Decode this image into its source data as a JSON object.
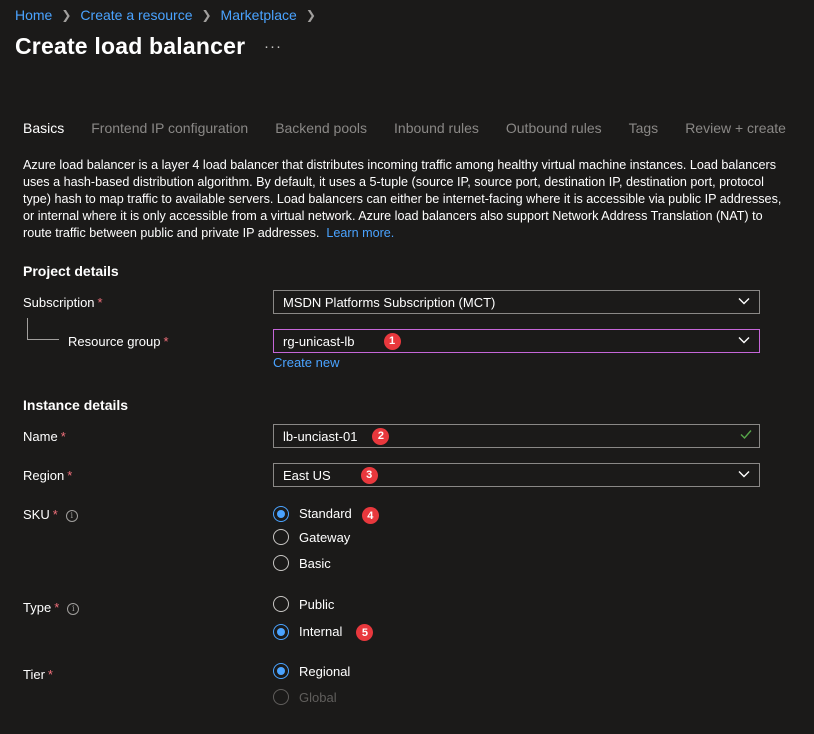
{
  "breadcrumb": {
    "home": "Home",
    "create_resource": "Create a resource",
    "marketplace": "Marketplace"
  },
  "page": {
    "title": "Create load balancer",
    "more": "···"
  },
  "tabs": [
    {
      "label": "Basics",
      "active": true
    },
    {
      "label": "Frontend IP configuration"
    },
    {
      "label": "Backend pools"
    },
    {
      "label": "Inbound rules"
    },
    {
      "label": "Outbound rules"
    },
    {
      "label": "Tags"
    },
    {
      "label": "Review + create"
    }
  ],
  "description": {
    "text": "Azure load balancer is a layer 4 load balancer that distributes incoming traffic among healthy virtual machine instances. Load balancers uses a hash-based distribution algorithm. By default, it uses a 5-tuple (source IP, source port, destination IP, destination port, protocol type) hash to map traffic to available servers. Load balancers can either be internet-facing where it is accessible via public IP addresses, or internal where it is only accessible from a virtual network. Azure load balancers also support Network Address Translation (NAT) to route traffic between public and private IP addresses.",
    "learn_more": "Learn more."
  },
  "project_details": {
    "heading": "Project details",
    "subscription_label": "Subscription",
    "subscription_value": "MSDN Platforms Subscription (MCT)",
    "resource_group_label": "Resource group",
    "resource_group_value": "rg-unicast-lb",
    "create_new": "Create new"
  },
  "instance_details": {
    "heading": "Instance details",
    "name_label": "Name",
    "name_value": "lb-unciast-01",
    "region_label": "Region",
    "region_value": "East US",
    "sku_label": "SKU",
    "sku_options": [
      "Standard",
      "Gateway",
      "Basic"
    ],
    "sku_selected": "Standard",
    "type_label": "Type",
    "type_options": [
      "Public",
      "Internal"
    ],
    "type_selected": "Internal",
    "tier_label": "Tier",
    "tier_options": [
      "Regional",
      "Global"
    ],
    "tier_selected": "Regional"
  },
  "required_marker": "*",
  "info_glyph": "i",
  "badges": [
    "1",
    "2",
    "3",
    "4",
    "5"
  ],
  "colors": {
    "background": "#1b1a19",
    "link": "#4aa3ff",
    "required": "#f1707b",
    "badge": "#e8383d",
    "focus_border": "#c566d8",
    "valid_check": "#57a64a"
  },
  "icons": {
    "breadcrumb_separator": "chevron-right-icon",
    "dropdown": "chevron-down-icon",
    "valid": "checkmark-icon",
    "info": "info-icon"
  }
}
